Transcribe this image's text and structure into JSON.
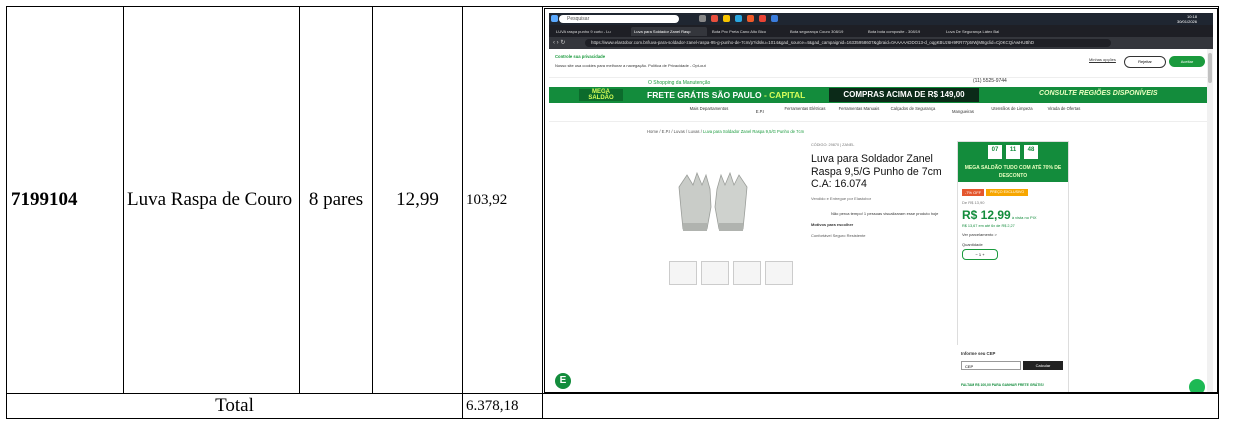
{
  "row": {
    "code": "7199104",
    "description": "Luva Raspa de Couro",
    "quantity": "8 pares",
    "unit_price": "12,99",
    "line_total": "103,92"
  },
  "footer": {
    "total_label": "Total",
    "total_value": "6.378,18"
  },
  "screenshot": {
    "taskbar": {
      "search_placeholder": "Pesquisar",
      "time": "10:18",
      "date": "30/01/2026"
    },
    "tabs": [
      "LUVA raspa punho 9 curto - Lu",
      "Luva para Soldador Zanel Rasp",
      "Bota Pvc Preta Cano Alto Bico",
      "Bota segurança Couro 308/19",
      "Bota bota composite - 308/19",
      "Luva De Segurança Látex Bal"
    ],
    "url": "https://www.elastobor.com.br/luva-para-soldador-zanel-raspa-95-g-punho-de-7cm/p?idsku=1014&gad_source=4&gad_campaignid=16335958607&gbraid=0AAAAADDO13-d_oqgKBUz6H9RR77p5IWjM8gclid=Cj0KCQiAwHUBhD",
    "privacy": {
      "title": "Controle sua privacidade",
      "link1": "AdOpt",
      "text": "Nosso site usa cookies para melhorar a navegação. Política de Privacidade - Opt-out",
      "options": "Minhas opções",
      "reject": "Rejeitar",
      "accept": "Aceitar"
    },
    "header": {
      "slogan": "O Shopping da Manutenção",
      "phone": "(11) 5525-9744"
    },
    "banner": {
      "mega": "MEGA SALDÃO",
      "frete_a": "FRETE GRÁTIS SÃO PAULO",
      "frete_b": " - CAPITAL",
      "compras": "COMPRAS ACIMA DE R$ 149,00",
      "regioes": "CONSULTE REGIÕES DISPONÍVEIS"
    },
    "menu": [
      "Mais Departamentos",
      "E.P.I",
      "Ferramentas Elétricas",
      "Ferramentas Manuais",
      "Calçados de Segurança",
      "Mangueiras",
      "Utensílios de Limpeza",
      "Virada de Ofertas"
    ],
    "breadcrumb": {
      "prefix": "Home / E.P.I / Luvas / Luvas / ",
      "current": "Luva para Soldador Zanel Raspa 9,5/G Punho de 7cm"
    },
    "product": {
      "code": "CÓDIGO: 29870  |  ZANEL",
      "name": "Luva para Soldador Zanel Raspa 9,5/G Punho de 7cm C.A: 16.074",
      "seller": "Vendido e Entregue por Elastobor",
      "watch": "Não perca tempo! 1 pessoas visualizaram esse produto hoje",
      "motivos": "Motivos para escolher",
      "features": "Confortável      Seguro      Resistente"
    },
    "buybox": {
      "timer": [
        "07",
        "11",
        "48"
      ],
      "mega": "MEGA SALDÃO  TUDO COM ATÉ 70% DE DESCONTO",
      "off": "-7% OFF",
      "exclusive": "PREÇO EXCLUSIVO SITE",
      "old_price": "De R$ 13,90",
      "price": "R$ 12,99",
      "price_note": " à vista no PIX",
      "installments": "R$ 13,67 em até 6x de R$ 2,27",
      "parcelamento": "Ver parcelamento  >",
      "qty_label": "Quantidade",
      "qty_value": "−  1  +",
      "buy_button": "COMPRAR AGORA"
    },
    "cep": {
      "label": "Informe seu CEP",
      "placeholder": "CEP",
      "button": "Calcular",
      "footer": "FALTAM R$ 100,00 PARA GANHAR FRETE GRÁTIS!"
    }
  }
}
